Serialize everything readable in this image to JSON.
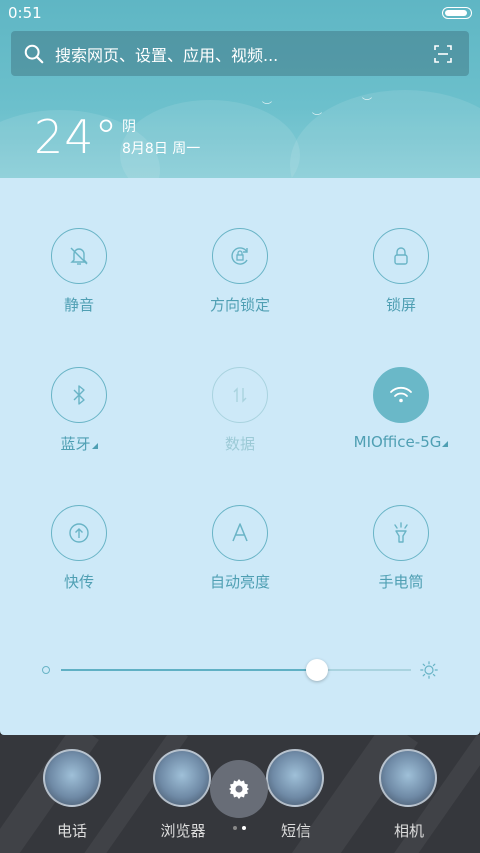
{
  "status_bar": {
    "time": "0:51"
  },
  "search": {
    "placeholder": "搜索网页、设置、应用、视频..."
  },
  "weather": {
    "temperature": "24°",
    "condition": "阴",
    "date": "8月8日 周一"
  },
  "quick_settings": [
    {
      "label": "静音",
      "icon": "bell-slash-icon",
      "state": "off"
    },
    {
      "label": "方向锁定",
      "icon": "rotation-lock-icon",
      "state": "off"
    },
    {
      "label": "锁屏",
      "icon": "lock-icon",
      "state": "off"
    },
    {
      "label": "蓝牙",
      "icon": "bluetooth-icon",
      "state": "off",
      "has_menu": true
    },
    {
      "label": "数据",
      "icon": "mobile-data-icon",
      "state": "disabled"
    },
    {
      "label": "MIOffice-5G",
      "icon": "wifi-icon",
      "state": "on",
      "has_menu": true
    },
    {
      "label": "快传",
      "icon": "quick-transfer-icon",
      "state": "off"
    },
    {
      "label": "自动亮度",
      "icon": "auto-brightness-icon",
      "state": "off"
    },
    {
      "label": "手电筒",
      "icon": "flashlight-icon",
      "state": "off"
    }
  ],
  "brightness": {
    "level": 0.73
  },
  "dock": [
    {
      "label": "电话"
    },
    {
      "label": "浏览器"
    },
    {
      "label": "短信"
    },
    {
      "label": "相机"
    }
  ],
  "colors": {
    "accent": "#6ab8c8",
    "panel_bg": "#cde9f8",
    "label": "#4f9fb3"
  }
}
